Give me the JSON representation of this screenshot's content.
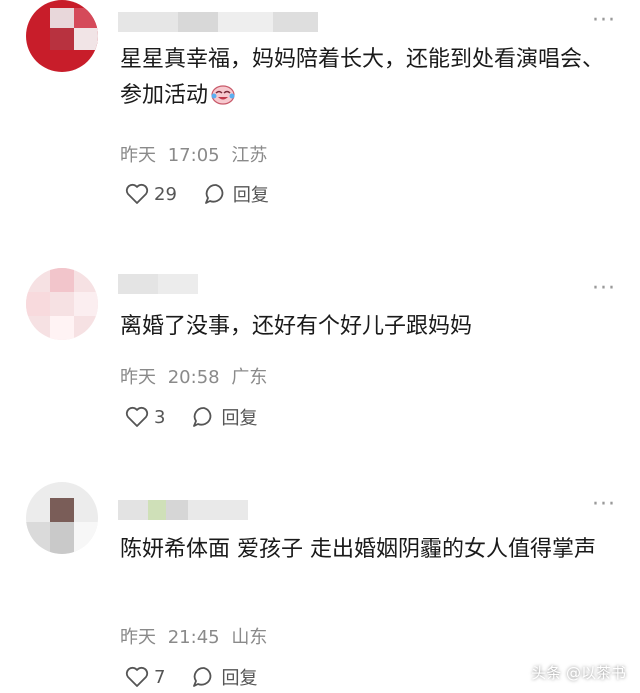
{
  "colors": {
    "meta": "#8a8a8a",
    "text": "#1a1a1a",
    "icon": "#555555"
  },
  "comments": [
    {
      "text": "星星真幸福，妈妈陪着长大，还能到处看演唱会、参加活动",
      "emoji_icon": "crying-laughing-emoji",
      "date": "昨天",
      "time": "17:05",
      "location": "江苏",
      "likes": "29",
      "reply_label": "回复"
    },
    {
      "text": "离婚了没事，还好有个好儿子跟妈妈",
      "date": "昨天",
      "time": "20:58",
      "location": "广东",
      "likes": "3",
      "reply_label": "回复"
    },
    {
      "text": "陈妍希体面 爱孩子 走出婚姻阴霾的女人值得掌声",
      "date": "昨天",
      "time": "21:45",
      "location": "山东",
      "likes": "7",
      "reply_label": "回复"
    }
  ],
  "watermark": "头条 @以茶书"
}
